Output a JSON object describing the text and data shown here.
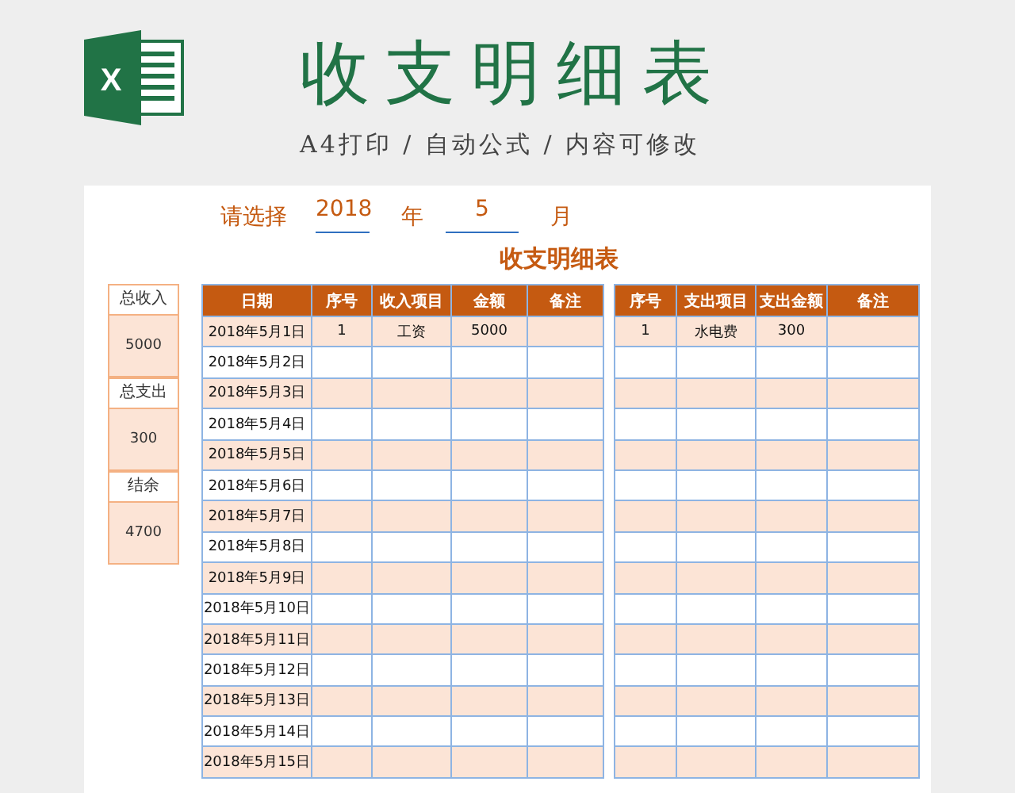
{
  "header": {
    "logo_letter": "X",
    "title": "收支明细表",
    "subtitle": "A4打印 / 自动公式 / 内容可修改"
  },
  "selector": {
    "prompt": "请选择",
    "year": "2018",
    "year_unit": "年",
    "month": "5",
    "month_unit": "月"
  },
  "sheet_title": "收支明细表",
  "summary": [
    {
      "label": "总收入",
      "value": "5000"
    },
    {
      "label": "总支出",
      "value": "300"
    },
    {
      "label": "结余",
      "value": "4700"
    }
  ],
  "income_table": {
    "columns": [
      "日期",
      "序号",
      "收入项目",
      "金额",
      "备注"
    ],
    "rows": [
      [
        "2018年5月1日",
        "1",
        "工资",
        "5000"
      ],
      [
        "2018年5月2日"
      ],
      [
        "2018年5月3日"
      ],
      [
        "2018年5月4日"
      ],
      [
        "2018年5月5日"
      ],
      [
        "2018年5月6日"
      ],
      [
        "2018年5月7日"
      ],
      [
        "2018年5月8日"
      ],
      [
        "2018年5月9日"
      ],
      [
        "2018年5月10日"
      ],
      [
        "2018年5月11日"
      ],
      [
        "2018年5月12日"
      ],
      [
        "2018年5月13日"
      ],
      [
        "2018年5月14日"
      ],
      [
        "2018年5月15日"
      ]
    ]
  },
  "expense_table": {
    "columns": [
      "序号",
      "支出项目",
      "支出金额",
      "备注"
    ],
    "rows": [
      [
        "1",
        "水电费",
        "300"
      ]
    ]
  }
}
